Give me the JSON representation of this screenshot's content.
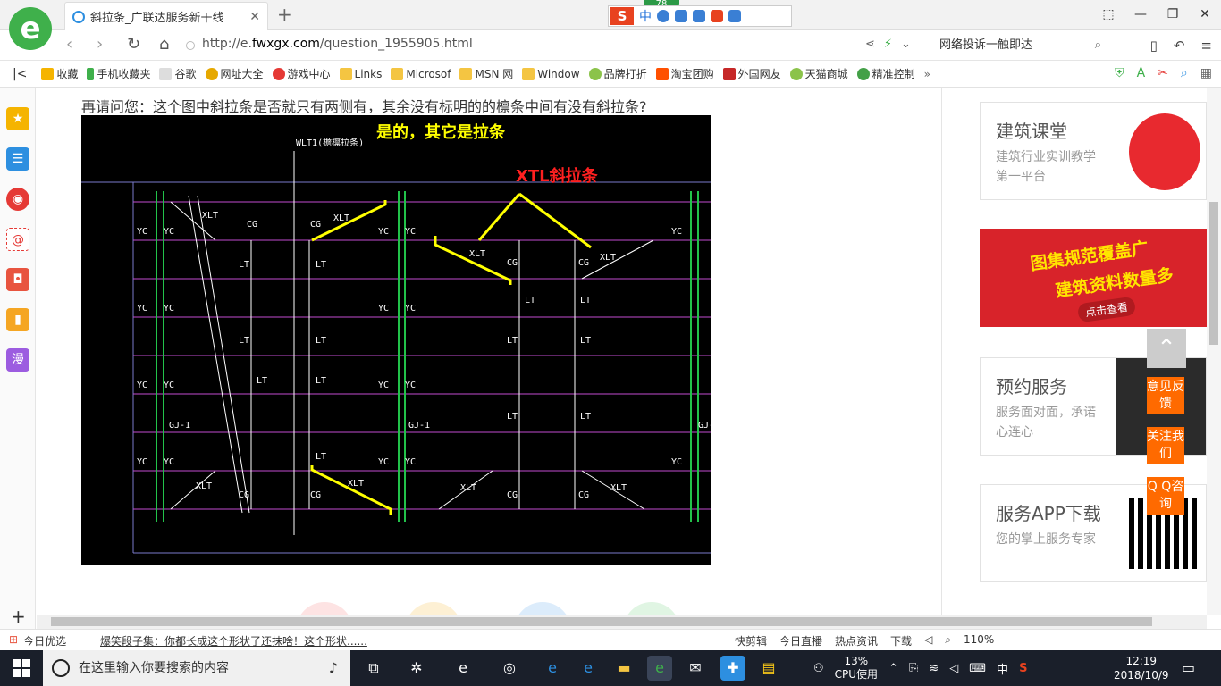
{
  "browser": {
    "tab_title": "斜拉条_广联达服务新干线",
    "ime_badge": "78",
    "ime_logo": "S",
    "ime_lang": "中",
    "url_prefix": "http://e.",
    "url_domain": "fwxgx.com",
    "url_path": "/question_1955905.html",
    "search_text": "网络投诉一触即达",
    "colors": {
      "accent": "#3fb04b",
      "tab_icon": "#2d8fe0"
    }
  },
  "bookmarks": [
    {
      "label": "收藏",
      "icon": "star-icon",
      "color": "#f5b400"
    },
    {
      "label": "手机收藏夹",
      "icon": "phone-icon",
      "color": "#3fb04b"
    },
    {
      "label": "谷歌",
      "icon": "page-icon",
      "color": "#bbbbbb"
    },
    {
      "label": "网址大全",
      "icon": "globe-icon",
      "color": "#e6a800"
    },
    {
      "label": "游戏中心",
      "icon": "game-icon",
      "color": "#e53935"
    },
    {
      "label": "Links",
      "icon": "folder-icon",
      "color": "#f4c542"
    },
    {
      "label": "Microsof",
      "icon": "folder-icon",
      "color": "#f4c542"
    },
    {
      "label": "MSN 网",
      "icon": "folder-icon",
      "color": "#f4c542"
    },
    {
      "label": "Window",
      "icon": "folder-icon",
      "color": "#f4c542"
    },
    {
      "label": "品牌打折",
      "icon": "leaf-icon",
      "color": "#8bc34a"
    },
    {
      "label": "淘宝团购",
      "icon": "taobao-icon",
      "color": "#ff5000"
    },
    {
      "label": "外国网友",
      "icon": "book-icon",
      "color": "#c62828"
    },
    {
      "label": "天猫商城",
      "icon": "leaf-icon",
      "color": "#8bc34a"
    },
    {
      "label": "精准控制",
      "icon": "wechat-icon",
      "color": "#43a047"
    }
  ],
  "page": {
    "question": "再请问您：这个图中斜拉条是否就只有两侧有，其余没有标明的的檩条中间有没有斜拉条?",
    "cad": {
      "answer": "是的，其它是拉条",
      "xtl_label": "XTL斜拉条",
      "wl_label": "WLT1(檐檩拉条)",
      "labels": {
        "yc": "YC",
        "lt": "LT",
        "xlt": "XLT",
        "cg": "CG",
        "gj": "GJ-1"
      }
    },
    "cards": [
      {
        "title": "建筑课堂",
        "desc": "建筑行业实训教学第一平台"
      },
      {
        "title": "预约服务",
        "desc": "服务面对面，承诺心连心"
      },
      {
        "title": "服务APP下载",
        "desc": "您的掌上服务专家"
      }
    ],
    "banner": {
      "line1": "图集规范覆盖广",
      "line2": "建筑资料数量多",
      "cta": "点击查看"
    },
    "float": {
      "feedback": "意见反馈",
      "follow": "关注我们",
      "qq": "Q Q咨询"
    }
  },
  "statusbar": {
    "daily": "今日优选",
    "news": "爆笑段子集：你都长成这个形状了还抹啥！这个形状......",
    "items": [
      "快剪辑",
      "今日直播",
      "热点资讯",
      "下载"
    ],
    "zoom": "110%"
  },
  "taskbar": {
    "search_placeholder": "在这里输入你要搜索的内容",
    "cpu_percent": "13%",
    "cpu_label": "CPU使用",
    "lang": "中",
    "time": "12:19",
    "date": "2018/10/9"
  }
}
